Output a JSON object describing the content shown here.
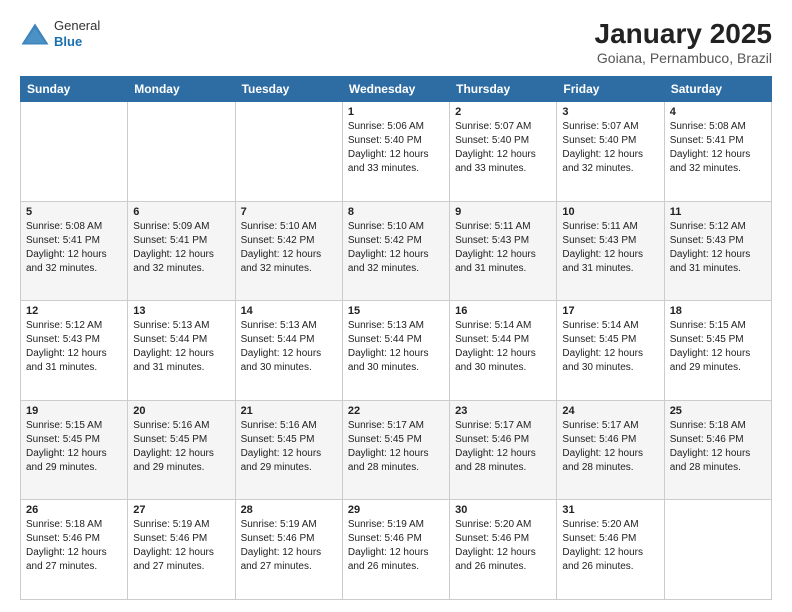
{
  "logo": {
    "general": "General",
    "blue": "Blue"
  },
  "title": "January 2025",
  "subtitle": "Goiana, Pernambuco, Brazil",
  "days_header": [
    "Sunday",
    "Monday",
    "Tuesday",
    "Wednesday",
    "Thursday",
    "Friday",
    "Saturday"
  ],
  "weeks": [
    [
      {
        "num": "",
        "info": ""
      },
      {
        "num": "",
        "info": ""
      },
      {
        "num": "",
        "info": ""
      },
      {
        "num": "1",
        "info": "Sunrise: 5:06 AM\nSunset: 5:40 PM\nDaylight: 12 hours\nand 33 minutes."
      },
      {
        "num": "2",
        "info": "Sunrise: 5:07 AM\nSunset: 5:40 PM\nDaylight: 12 hours\nand 33 minutes."
      },
      {
        "num": "3",
        "info": "Sunrise: 5:07 AM\nSunset: 5:40 PM\nDaylight: 12 hours\nand 32 minutes."
      },
      {
        "num": "4",
        "info": "Sunrise: 5:08 AM\nSunset: 5:41 PM\nDaylight: 12 hours\nand 32 minutes."
      }
    ],
    [
      {
        "num": "5",
        "info": "Sunrise: 5:08 AM\nSunset: 5:41 PM\nDaylight: 12 hours\nand 32 minutes."
      },
      {
        "num": "6",
        "info": "Sunrise: 5:09 AM\nSunset: 5:41 PM\nDaylight: 12 hours\nand 32 minutes."
      },
      {
        "num": "7",
        "info": "Sunrise: 5:10 AM\nSunset: 5:42 PM\nDaylight: 12 hours\nand 32 minutes."
      },
      {
        "num": "8",
        "info": "Sunrise: 5:10 AM\nSunset: 5:42 PM\nDaylight: 12 hours\nand 32 minutes."
      },
      {
        "num": "9",
        "info": "Sunrise: 5:11 AM\nSunset: 5:43 PM\nDaylight: 12 hours\nand 31 minutes."
      },
      {
        "num": "10",
        "info": "Sunrise: 5:11 AM\nSunset: 5:43 PM\nDaylight: 12 hours\nand 31 minutes."
      },
      {
        "num": "11",
        "info": "Sunrise: 5:12 AM\nSunset: 5:43 PM\nDaylight: 12 hours\nand 31 minutes."
      }
    ],
    [
      {
        "num": "12",
        "info": "Sunrise: 5:12 AM\nSunset: 5:43 PM\nDaylight: 12 hours\nand 31 minutes."
      },
      {
        "num": "13",
        "info": "Sunrise: 5:13 AM\nSunset: 5:44 PM\nDaylight: 12 hours\nand 31 minutes."
      },
      {
        "num": "14",
        "info": "Sunrise: 5:13 AM\nSunset: 5:44 PM\nDaylight: 12 hours\nand 30 minutes."
      },
      {
        "num": "15",
        "info": "Sunrise: 5:13 AM\nSunset: 5:44 PM\nDaylight: 12 hours\nand 30 minutes."
      },
      {
        "num": "16",
        "info": "Sunrise: 5:14 AM\nSunset: 5:44 PM\nDaylight: 12 hours\nand 30 minutes."
      },
      {
        "num": "17",
        "info": "Sunrise: 5:14 AM\nSunset: 5:45 PM\nDaylight: 12 hours\nand 30 minutes."
      },
      {
        "num": "18",
        "info": "Sunrise: 5:15 AM\nSunset: 5:45 PM\nDaylight: 12 hours\nand 29 minutes."
      }
    ],
    [
      {
        "num": "19",
        "info": "Sunrise: 5:15 AM\nSunset: 5:45 PM\nDaylight: 12 hours\nand 29 minutes."
      },
      {
        "num": "20",
        "info": "Sunrise: 5:16 AM\nSunset: 5:45 PM\nDaylight: 12 hours\nand 29 minutes."
      },
      {
        "num": "21",
        "info": "Sunrise: 5:16 AM\nSunset: 5:45 PM\nDaylight: 12 hours\nand 29 minutes."
      },
      {
        "num": "22",
        "info": "Sunrise: 5:17 AM\nSunset: 5:45 PM\nDaylight: 12 hours\nand 28 minutes."
      },
      {
        "num": "23",
        "info": "Sunrise: 5:17 AM\nSunset: 5:46 PM\nDaylight: 12 hours\nand 28 minutes."
      },
      {
        "num": "24",
        "info": "Sunrise: 5:17 AM\nSunset: 5:46 PM\nDaylight: 12 hours\nand 28 minutes."
      },
      {
        "num": "25",
        "info": "Sunrise: 5:18 AM\nSunset: 5:46 PM\nDaylight: 12 hours\nand 28 minutes."
      }
    ],
    [
      {
        "num": "26",
        "info": "Sunrise: 5:18 AM\nSunset: 5:46 PM\nDaylight: 12 hours\nand 27 minutes."
      },
      {
        "num": "27",
        "info": "Sunrise: 5:19 AM\nSunset: 5:46 PM\nDaylight: 12 hours\nand 27 minutes."
      },
      {
        "num": "28",
        "info": "Sunrise: 5:19 AM\nSunset: 5:46 PM\nDaylight: 12 hours\nand 27 minutes."
      },
      {
        "num": "29",
        "info": "Sunrise: 5:19 AM\nSunset: 5:46 PM\nDaylight: 12 hours\nand 26 minutes."
      },
      {
        "num": "30",
        "info": "Sunrise: 5:20 AM\nSunset: 5:46 PM\nDaylight: 12 hours\nand 26 minutes."
      },
      {
        "num": "31",
        "info": "Sunrise: 5:20 AM\nSunset: 5:46 PM\nDaylight: 12 hours\nand 26 minutes."
      },
      {
        "num": "",
        "info": ""
      }
    ]
  ]
}
